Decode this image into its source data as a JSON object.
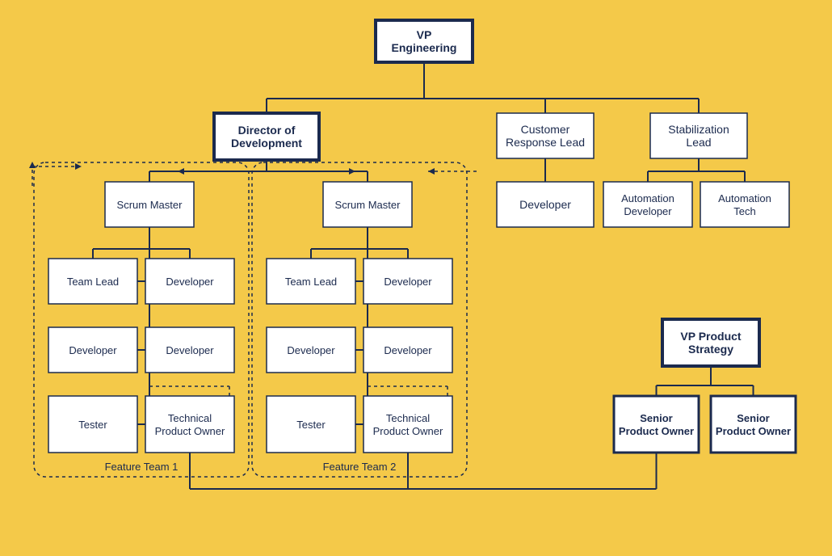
{
  "chart_data": {
    "type": "org_chart",
    "nodes": {
      "vp_eng": {
        "label": "VP Engineering",
        "emphasis": "thick",
        "children": [
          "dir_dev",
          "cust_resp",
          "stab_lead"
        ]
      },
      "dir_dev": {
        "label": "Director of Development",
        "emphasis": "thick",
        "children": [
          "scrum1",
          "scrum2"
        ]
      },
      "cust_resp": {
        "label": "Customer Response Lead",
        "emphasis": "thin",
        "children": [
          "cust_dev"
        ]
      },
      "stab_lead": {
        "label": "Stabilization Lead",
        "emphasis": "thin",
        "children": [
          "auto_dev",
          "auto_tech"
        ]
      },
      "cust_dev": {
        "label": "Developer",
        "emphasis": "thin"
      },
      "auto_dev": {
        "label": "Automation Developer",
        "emphasis": "thin"
      },
      "auto_tech": {
        "label": "Automation Tech",
        "emphasis": "thin"
      },
      "scrum1": {
        "label": "Scrum Master",
        "emphasis": "thin",
        "children": [
          "t1_lead",
          "t1_dev1",
          "t1_dev2",
          "t1_dev3",
          "t1_test",
          "t1_tpo"
        ]
      },
      "t1_lead": {
        "label": "Team Lead",
        "emphasis": "thin"
      },
      "t1_dev1": {
        "label": "Developer",
        "emphasis": "thin"
      },
      "t1_dev2": {
        "label": "Developer",
        "emphasis": "thin"
      },
      "t1_dev3": {
        "label": "Developer",
        "emphasis": "thin"
      },
      "t1_test": {
        "label": "Tester",
        "emphasis": "thin"
      },
      "t1_tpo": {
        "label": "Technical Product Owner",
        "emphasis": "thin"
      },
      "scrum2": {
        "label": "Scrum Master",
        "emphasis": "thin",
        "children": [
          "t2_lead",
          "t2_dev1",
          "t2_dev2",
          "t2_dev3",
          "t2_test",
          "t2_tpo"
        ]
      },
      "t2_lead": {
        "label": "Team Lead",
        "emphasis": "thin"
      },
      "t2_dev1": {
        "label": "Developer",
        "emphasis": "thin"
      },
      "t2_dev2": {
        "label": "Developer",
        "emphasis": "thin"
      },
      "t2_dev3": {
        "label": "Developer",
        "emphasis": "thin"
      },
      "t2_test": {
        "label": "Tester",
        "emphasis": "thin"
      },
      "t2_tpo": {
        "label": "Technical Product Owner",
        "emphasis": "thin"
      },
      "vp_prod": {
        "label": "VP Product Strategy",
        "emphasis": "thick",
        "children": [
          "spo1",
          "spo2"
        ]
      },
      "spo1": {
        "label": "Senior Product Owner",
        "emphasis": "mid"
      },
      "spo2": {
        "label": "Senior Product Owner",
        "emphasis": "mid"
      }
    },
    "groups": {
      "team1": {
        "label": "Feature Team 1",
        "members": [
          "scrum1",
          "t1_lead",
          "t1_dev1",
          "t1_dev2",
          "t1_dev3",
          "t1_test",
          "t1_tpo"
        ]
      },
      "team2": {
        "label": "Feature Team 2",
        "members": [
          "scrum2",
          "t2_lead",
          "t2_dev1",
          "t2_dev2",
          "t2_dev3",
          "t2_test",
          "t2_tpo"
        ]
      }
    },
    "cross_links": [
      {
        "from": "spo1",
        "to": "t1_tpo"
      },
      {
        "from": "spo1",
        "to": "t2_tpo"
      }
    ]
  },
  "layout": {
    "boxW_s": 105,
    "boxW_m": 112,
    "boxH": 60
  }
}
